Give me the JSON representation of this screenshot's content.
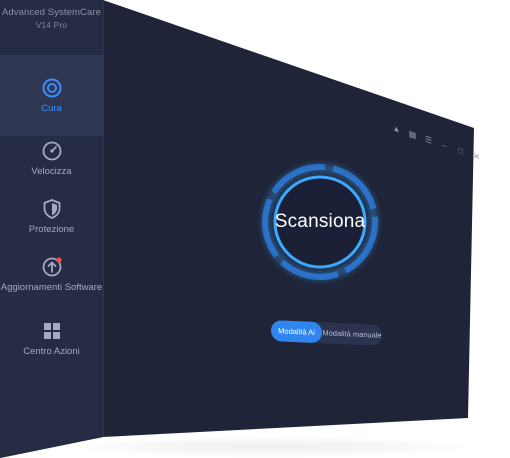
{
  "app": {
    "brand_line1": "Advanced SystemCare",
    "brand_line2": "V14 Pro"
  },
  "sidebar": {
    "items": [
      {
        "label": "Cura",
        "icon": "care-icon",
        "active": true
      },
      {
        "label": "Velocizza",
        "icon": "speedometer-icon",
        "active": false
      },
      {
        "label": "Protezione",
        "icon": "shield-icon",
        "active": false
      },
      {
        "label": "Aggiornamenti Software",
        "icon": "update-icon",
        "active": false,
        "notification": true
      },
      {
        "label": "Centro Azioni",
        "icon": "grid-icon",
        "active": false
      }
    ]
  },
  "titlebar": {
    "icons": [
      "bell-icon",
      "gift-icon",
      "menu-icon",
      "minimize-icon",
      "maximize-icon",
      "close-icon"
    ]
  },
  "main": {
    "scan_button": "Scansiona",
    "modes": {
      "ai": "Modalità Ai",
      "manual": "Modalità manuale",
      "selected": "ai"
    }
  },
  "colors": {
    "background": "#1f2438",
    "sidebar": "#262c44",
    "accent": "#2f86f0",
    "ring": "#3aa0ff",
    "notification": "#ff4b4b"
  }
}
